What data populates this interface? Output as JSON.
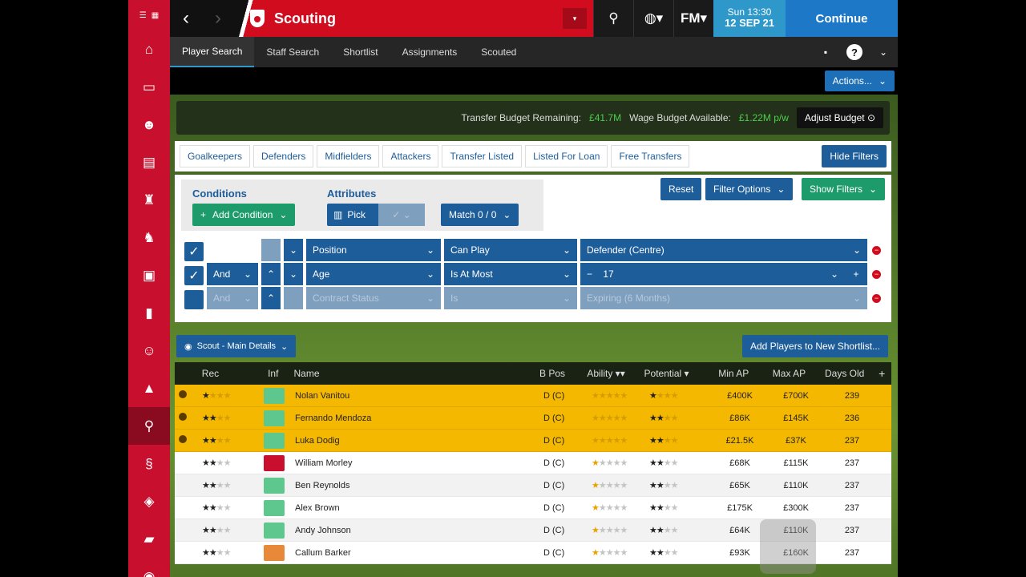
{
  "sidebar": {
    "top_icons": [
      "menu-icon",
      "flag-icon"
    ],
    "items": [
      "home-icon",
      "inbox-icon",
      "squad-icon",
      "schedule-icon",
      "trophy-icon",
      "tactics-icon",
      "stats-icon",
      "notes-icon",
      "staff-icon",
      "training-icon",
      "scouting-icon",
      "club-icon",
      "club-badge-icon",
      "finances-icon",
      "world-icon"
    ]
  },
  "header": {
    "title": "Scouting",
    "date_line1": "Sun 13:30",
    "date_line2": "12 SEP 21",
    "continue_label": "Continue",
    "fm_logo": "FM"
  },
  "tabs": [
    "Player Search",
    "Staff Search",
    "Shortlist",
    "Assignments",
    "Scouted"
  ],
  "actions_label": "Actions...",
  "budget": {
    "transfer_label": "Transfer Budget Remaining:",
    "transfer_value": "£41.7M",
    "wage_label": "Wage Budget Available:",
    "wage_value": "£1.22M p/w",
    "adjust_label": "Adjust Budget"
  },
  "positions": [
    "Goalkeepers",
    "Defenders",
    "Midfielders",
    "Attackers",
    "Transfer Listed",
    "Listed For Loan",
    "Free Transfers"
  ],
  "hide_filters": "Hide Filters",
  "conditions": {
    "heading": "Conditions",
    "add_label": "Add Condition",
    "attributes_heading": "Attributes",
    "pick_label": "Pick",
    "match_label": "Match 0 / 0",
    "reset_label": "Reset",
    "filter_options_label": "Filter Options",
    "show_filters_label": "Show Filters"
  },
  "filter_rows": [
    {
      "checked": true,
      "join": "",
      "field": "Position",
      "op": "Can Play",
      "value": "Defender (Centre)",
      "enabled": true
    },
    {
      "checked": true,
      "join": "And",
      "field": "Age",
      "op": "Is At Most",
      "value": "17",
      "enabled": true
    },
    {
      "checked": false,
      "join": "And",
      "field": "Contract Status",
      "op": "Is",
      "value": "Expiring (6 Months)",
      "enabled": false
    }
  ],
  "view_label": "Scout - Main Details",
  "add_shortlist_label": "Add Players to New Shortlist...",
  "columns": [
    "Rec",
    "Inf",
    "Name",
    "B Pos",
    "Ability",
    "Potential",
    "Min AP",
    "Max AP",
    "Days Old",
    "+"
  ],
  "rows": [
    {
      "name": "Nolan Vanitou",
      "bpos": "D (C)",
      "min": "£400K",
      "max": "£700K",
      "days": "239",
      "style": "yellow",
      "rec": 1,
      "inf": "green",
      "ab": 0,
      "pot": 1,
      "sel": true
    },
    {
      "name": "Fernando Mendoza",
      "bpos": "D (C)",
      "min": "£86K",
      "max": "£145K",
      "days": "236",
      "style": "yellow",
      "rec": 2,
      "inf": "green",
      "ab": 0,
      "pot": 2,
      "sel": true
    },
    {
      "name": "Luka Dodig",
      "bpos": "D (C)",
      "min": "£21.5K",
      "max": "£37K",
      "days": "237",
      "style": "yellow",
      "rec": 2,
      "inf": "green",
      "ab": 0,
      "pot": 2,
      "sel": true
    },
    {
      "name": "William Morley",
      "bpos": "D (C)",
      "min": "£68K",
      "max": "£115K",
      "days": "237",
      "style": "white",
      "rec": 2,
      "inf": "red",
      "ab": 1,
      "pot": 2,
      "sel": false
    },
    {
      "name": "Ben Reynolds",
      "bpos": "D (C)",
      "min": "£65K",
      "max": "£110K",
      "days": "237",
      "style": "grey",
      "rec": 2,
      "inf": "green",
      "ab": 1,
      "pot": 2,
      "sel": false
    },
    {
      "name": "Alex Brown",
      "bpos": "D (C)",
      "min": "£175K",
      "max": "£300K",
      "days": "237",
      "style": "white",
      "rec": 2,
      "inf": "green",
      "ab": 1,
      "pot": 2,
      "sel": false
    },
    {
      "name": "Andy Johnson",
      "bpos": "D (C)",
      "min": "£64K",
      "max": "£110K",
      "days": "237",
      "style": "grey",
      "rec": 2,
      "inf": "green",
      "ab": 1,
      "pot": 2,
      "sel": false
    },
    {
      "name": "Callum Barker",
      "bpos": "D (C)",
      "min": "£93K",
      "max": "£160K",
      "days": "237",
      "style": "white",
      "rec": 2,
      "inf": "orange",
      "ab": 1,
      "pot": 2,
      "sel": false
    }
  ]
}
